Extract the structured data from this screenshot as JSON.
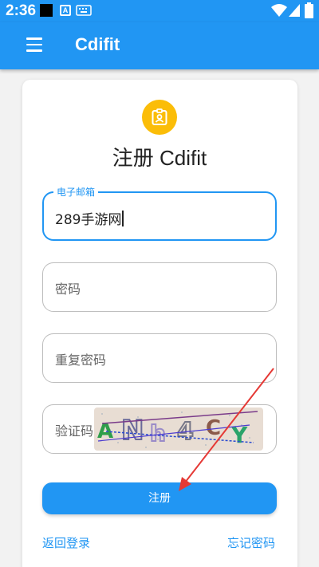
{
  "status_bar": {
    "time": "2:36",
    "notif_a_glyph": "A"
  },
  "app_bar": {
    "title": "Cdifit",
    "menu_icon": "hamburger-menu-icon"
  },
  "form": {
    "logo_icon": "contact-badge-icon",
    "title": "注册 Cdifit",
    "email": {
      "label": "电子邮箱",
      "value": "289手游网"
    },
    "password": {
      "placeholder": "密码"
    },
    "confirm_password": {
      "placeholder": "重复密码"
    },
    "captcha": {
      "placeholder": "验证码",
      "image_text": "ANh4CY"
    },
    "submit_label": "注册",
    "back_to_login": "返回登录",
    "forgot_password": "忘记密码"
  },
  "colors": {
    "primary": "#2196f3",
    "logo_bg": "#fbbd08",
    "annotation_arrow": "#e53935"
  }
}
